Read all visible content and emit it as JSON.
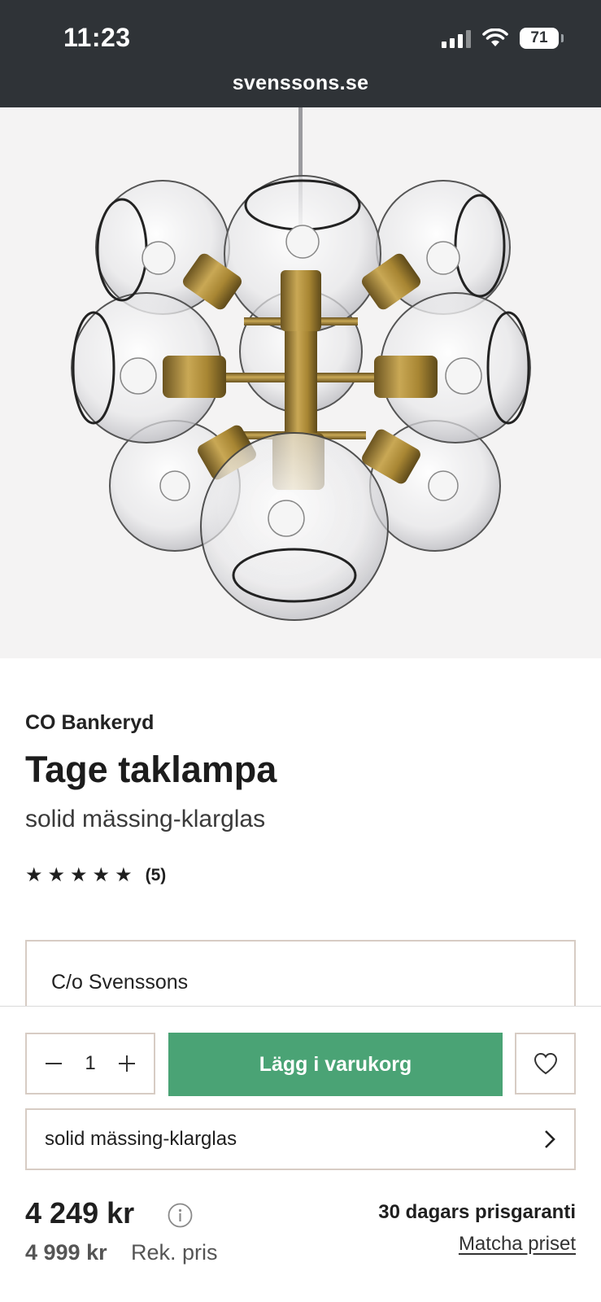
{
  "status_bar": {
    "time": "11:23",
    "battery": "71",
    "url": "svenssons.se"
  },
  "product": {
    "brand": "CO Bankeryd",
    "title": "Tage taklampa",
    "variant": "solid mässing-klarglas",
    "rating": {
      "stars": 5,
      "review_count": "(5)"
    },
    "seller": "C/o Svenssons"
  },
  "purchase": {
    "quantity": "1",
    "add_to_cart_label": "Lägg i varukorg",
    "variant_select_label": "solid mässing-klarglas",
    "price": "4 249 kr",
    "old_price": "4 999 kr",
    "rek_label": "Rek. pris",
    "guarantee": "30 dagars prisgaranti",
    "match_price_label": "Matcha priset"
  },
  "icons": {
    "quantity_minus": "minus-icon",
    "quantity_plus": "plus-icon",
    "wishlist": "heart-icon",
    "variant_chevron": "chevron-right-icon",
    "price_info": "info-icon"
  },
  "colors": {
    "status_bar_bg": "#2f3337",
    "cta_green": "#4aa375",
    "border_beige": "#d7ccc4",
    "brass": "#b08d3a"
  }
}
